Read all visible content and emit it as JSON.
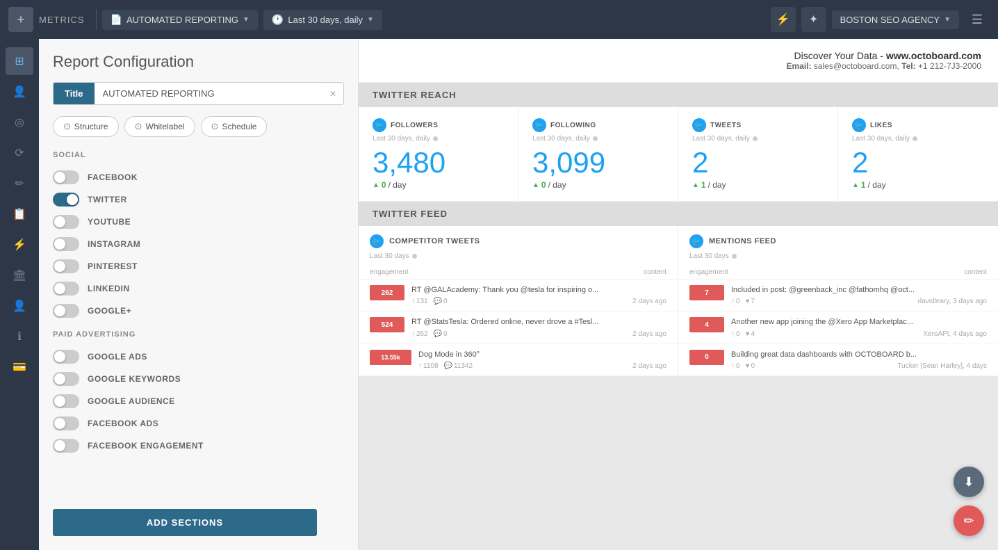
{
  "topNav": {
    "logo": "+",
    "appName": "METRICS",
    "reportLabel": "AUTOMATED REPORTING",
    "dateRange": "Last 30 days, daily",
    "agencyName": "BOSTON SEO AGENCY",
    "icons": {
      "bolt": "⚡",
      "flash": "✦",
      "chevronDown": "▼",
      "hamburger": "☰",
      "clock": "🕐"
    }
  },
  "sidebar": {
    "icons": [
      {
        "name": "dashboard-icon",
        "symbol": "⊞"
      },
      {
        "name": "users-icon",
        "symbol": "👤"
      },
      {
        "name": "analytics-icon",
        "symbol": "◎"
      },
      {
        "name": "connections-icon",
        "symbol": "⟳"
      },
      {
        "name": "pen-icon",
        "symbol": "✏"
      },
      {
        "name": "clipboard-icon",
        "symbol": "📋"
      },
      {
        "name": "lightning-icon",
        "symbol": "⚡"
      },
      {
        "name": "building-icon",
        "symbol": "🏛"
      },
      {
        "name": "settings-icon",
        "symbol": "⚙"
      },
      {
        "name": "info-icon",
        "symbol": "ℹ"
      },
      {
        "name": "billing-icon",
        "symbol": "💳"
      }
    ]
  },
  "leftPanel": {
    "title": "Report Configuration",
    "titleField": {
      "label": "Title",
      "value": "AUTOMATED REPORTING"
    },
    "tabs": [
      {
        "id": "structure",
        "label": "Structure",
        "icon": "⊙"
      },
      {
        "id": "whitelabel",
        "label": "Whitelabel",
        "icon": "⊙"
      },
      {
        "id": "schedule",
        "label": "Schedule",
        "icon": "⊙"
      }
    ],
    "sections": {
      "social": {
        "header": "SOCIAL",
        "items": [
          {
            "id": "facebook",
            "label": "FACEBOOK",
            "on": false
          },
          {
            "id": "twitter",
            "label": "TWITTER",
            "on": true
          },
          {
            "id": "youtube",
            "label": "YOUTUBE",
            "on": false
          },
          {
            "id": "instagram",
            "label": "INSTAGRAM",
            "on": false
          },
          {
            "id": "pinterest",
            "label": "PINTEREST",
            "on": false
          },
          {
            "id": "linkedin",
            "label": "LINKEDIN",
            "on": false
          },
          {
            "id": "googleplus",
            "label": "GOOGLE+",
            "on": false
          }
        ]
      },
      "paidAdvertising": {
        "header": "PAID ADVERTISING",
        "items": [
          {
            "id": "googleads",
            "label": "GOOGLE ADS",
            "on": false
          },
          {
            "id": "googlekeywords",
            "label": "GOOGLE KEYWORDS",
            "on": false
          },
          {
            "id": "googleaudience",
            "label": "GOOGLE AUDIENCE",
            "on": false
          },
          {
            "id": "facebookads",
            "label": "FACEBOOK ADS",
            "on": false
          },
          {
            "id": "facebookengagement",
            "label": "FACEBOOK ENGAGEMENT",
            "on": false
          }
        ]
      }
    },
    "addSectionsButton": "ADD SECTIONS"
  },
  "reportHeader": {
    "titleText": "Discover Your Data - ",
    "website": "www.octoboard.com",
    "emailLabel": "Email: ",
    "email": "sales@octoboard.com",
    "telLabel": "Tel: ",
    "tel": "+1 212-7J3-2000"
  },
  "twitterReach": {
    "sectionTitle": "TWITTER REACH",
    "stats": [
      {
        "label": "FOLLOWERS",
        "sublabel": "Last 30 days, daily",
        "value": "3,480",
        "delta": "0",
        "deltaLabel": "/ day"
      },
      {
        "label": "FOLLOWING",
        "sublabel": "Last 30 days, daily",
        "value": "3,099",
        "delta": "0",
        "deltaLabel": "/ day"
      },
      {
        "label": "TWEETS",
        "sublabel": "Last 30 days, daily",
        "value": "2",
        "delta": "1",
        "deltaLabel": "/ day"
      },
      {
        "label": "LIKES",
        "sublabel": "Last 30 days, daily",
        "value": "2",
        "delta": "1",
        "deltaLabel": "/ day"
      }
    ]
  },
  "twitterFeed": {
    "sectionTitle": "TWITTER FEED",
    "panels": [
      {
        "id": "competitor-tweets",
        "title": "COMPETITOR TWEETS",
        "sublabel": "Last 30 days",
        "colHeaders": [
          "engagement",
          "content"
        ],
        "items": [
          {
            "barValue": "262",
            "barColor": "red",
            "text": "RT @GALAcademy: Thank you @tesla for inspiring o...",
            "likes": "131",
            "comments": "0",
            "time": "2 days ago"
          },
          {
            "barValue": "524",
            "barColor": "red",
            "text": "RT @StatsTesla: Ordered online, never drove a #Tesl...",
            "likes": "262",
            "comments": "0",
            "time": "2 days ago"
          },
          {
            "barValue": "13.55k",
            "barColor": "red",
            "text": "Dog Mode in 360°",
            "likes": "1108",
            "comments": "11342",
            "time": "2 days ago"
          }
        ]
      },
      {
        "id": "mentions-feed",
        "title": "MENTIONS FEED",
        "sublabel": "Last 30 days",
        "colHeaders": [
          "engagement",
          "content"
        ],
        "items": [
          {
            "barValue": "7",
            "barColor": "red",
            "text": "Included in post: @greenback_inc @fathomhq @oct...",
            "likes": "0",
            "hearts": "7",
            "time": "davidleary, 3 days ago"
          },
          {
            "barValue": "4",
            "barColor": "red",
            "text": "Another new app joining the @Xero App Marketplac...",
            "likes": "0",
            "hearts": "4",
            "time": "XeroAPI, 4 days ago"
          },
          {
            "barValue": "0",
            "barColor": "red",
            "text": "Building great data dashboards with OCTOBOARD b...",
            "likes": "0",
            "hearts": "0",
            "time": "Tucker [Sean Harley], 4 days"
          }
        ]
      }
    ]
  },
  "fabs": {
    "download": "⬇",
    "edit": "✏"
  }
}
